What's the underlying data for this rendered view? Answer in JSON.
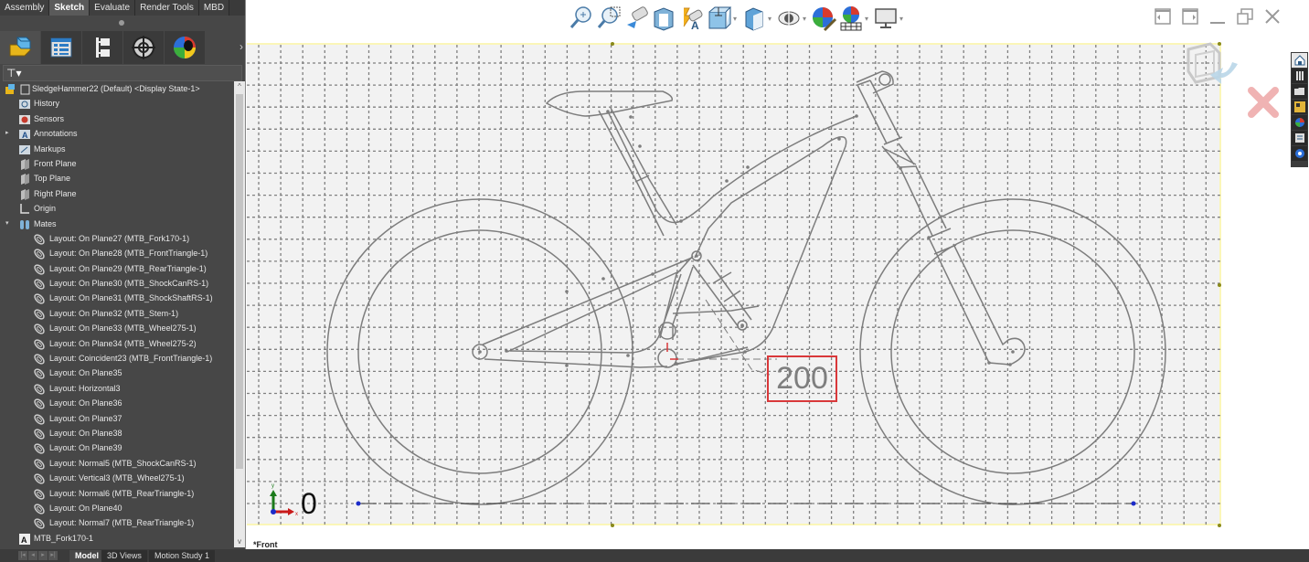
{
  "command_manager": {
    "tabs": [
      {
        "label": "Assembly",
        "active": false
      },
      {
        "label": "Sketch",
        "active": true
      },
      {
        "label": "Evaluate",
        "active": false
      },
      {
        "label": "Render Tools",
        "active": false
      },
      {
        "label": "MBD",
        "active": false
      }
    ]
  },
  "manager_tabs": [
    {
      "name": "featuremanager-tab",
      "icon": "featuremanager-icon"
    },
    {
      "name": "propertymanager-tab",
      "icon": "propertymanager-icon"
    },
    {
      "name": "configurationmanager-tab",
      "icon": "configurationmanager-icon"
    },
    {
      "name": "dimxpertmanager-tab",
      "icon": "crosshair-icon"
    },
    {
      "name": "displaymanager-tab",
      "icon": "appearance-ball-icon"
    }
  ],
  "tree": {
    "root": "SledgeHammer22 (Default) <Display State-1>",
    "items": [
      {
        "label": "History",
        "icon": "history-icon",
        "level": 1,
        "expandable": false
      },
      {
        "label": "Sensors",
        "icon": "sensors-icon",
        "level": 1,
        "expandable": false
      },
      {
        "label": "Annotations",
        "icon": "annotations-icon",
        "level": 1,
        "expandable": true,
        "expanded": false
      },
      {
        "label": "Markups",
        "icon": "markups-icon",
        "level": 1,
        "expandable": false
      },
      {
        "label": "Front Plane",
        "icon": "plane-icon",
        "level": 1,
        "expandable": false
      },
      {
        "label": "Top Plane",
        "icon": "plane-icon",
        "level": 1,
        "expandable": false
      },
      {
        "label": "Right Plane",
        "icon": "plane-icon",
        "level": 1,
        "expandable": false
      },
      {
        "label": "Origin",
        "icon": "origin-icon",
        "level": 1,
        "expandable": false
      },
      {
        "label": "Mates",
        "icon": "mates-icon",
        "level": 1,
        "expandable": true,
        "expanded": true
      },
      {
        "label": "Layout: On Plane27 (MTB_Fork170-1)",
        "icon": "mate-icon",
        "level": 2
      },
      {
        "label": "Layout: On Plane28 (MTB_FrontTriangle-1)",
        "icon": "mate-icon",
        "level": 2
      },
      {
        "label": "Layout: On Plane29 (MTB_RearTriangle-1)",
        "icon": "mate-icon",
        "level": 2
      },
      {
        "label": "Layout: On Plane30 (MTB_ShockCanRS-1)",
        "icon": "mate-icon",
        "level": 2
      },
      {
        "label": "Layout: On Plane31 (MTB_ShockShaftRS-1)",
        "icon": "mate-icon",
        "level": 2
      },
      {
        "label": "Layout: On Plane32 (MTB_Stem-1)",
        "icon": "mate-icon",
        "level": 2
      },
      {
        "label": "Layout: On Plane33 (MTB_Wheel275-1)",
        "icon": "mate-icon",
        "level": 2
      },
      {
        "label": "Layout: On Plane34 (MTB_Wheel275-2)",
        "icon": "mate-icon",
        "level": 2
      },
      {
        "label": "Layout: Coincident23 (MTB_FrontTriangle-1)",
        "icon": "mate-icon",
        "level": 2
      },
      {
        "label": "Layout: On Plane35",
        "icon": "mate-icon",
        "level": 2
      },
      {
        "label": "Layout: Horizontal3",
        "icon": "mate-icon",
        "level": 2
      },
      {
        "label": "Layout: On Plane36",
        "icon": "mate-icon",
        "level": 2
      },
      {
        "label": "Layout: On Plane37",
        "icon": "mate-icon",
        "level": 2
      },
      {
        "label": "Layout: On Plane38",
        "icon": "mate-icon",
        "level": 2
      },
      {
        "label": "Layout: On Plane39",
        "icon": "mate-icon",
        "level": 2
      },
      {
        "label": "Layout: Normal5 (MTB_ShockCanRS-1)",
        "icon": "mate-icon",
        "level": 2
      },
      {
        "label": "Layout: Vertical3 (MTB_Wheel275-1)",
        "icon": "mate-icon",
        "level": 2
      },
      {
        "label": "Layout: Normal6 (MTB_RearTriangle-1)",
        "icon": "mate-icon",
        "level": 2
      },
      {
        "label": "Layout: On Plane40",
        "icon": "mate-icon",
        "level": 2
      },
      {
        "label": "Layout: Normal7 (MTB_RearTriangle-1)",
        "icon": "mate-icon",
        "level": 2
      },
      {
        "label": "MTB_Fork170-1",
        "icon": "part-icon",
        "level": 1
      }
    ]
  },
  "bottom_tabs": [
    {
      "label": "Model",
      "active": true
    },
    {
      "label": "3D Views",
      "active": false
    },
    {
      "label": "Motion Study 1",
      "active": false
    }
  ],
  "heads_up_toolbar": [
    {
      "name": "zoom-to-fit",
      "icon": "zoom-to-fit-icon",
      "dropdown": false
    },
    {
      "name": "zoom-to-area",
      "icon": "zoom-area-icon",
      "dropdown": false
    },
    {
      "name": "previous-view",
      "icon": "previous-view-icon",
      "dropdown": false
    },
    {
      "name": "section-view",
      "icon": "section-view-icon",
      "dropdown": false
    },
    {
      "name": "dynamic-annotation-views",
      "icon": "dynamic-annotation-icon",
      "dropdown": false
    },
    {
      "name": "view-orientation",
      "icon": "view-orientation-icon",
      "dropdown": true
    },
    {
      "name": "display-style",
      "icon": "display-style-icon",
      "dropdown": true
    },
    {
      "name": "hide-show-items",
      "icon": "eye-icon",
      "dropdown": true
    },
    {
      "name": "edit-appearance",
      "icon": "edit-appearance-icon",
      "dropdown": false
    },
    {
      "name": "apply-scene",
      "icon": "scene-icon",
      "dropdown": true
    },
    {
      "name": "view-settings",
      "icon": "monitor-icon",
      "dropdown": true
    }
  ],
  "task_pane": [
    {
      "name": "solidworks-resources",
      "icon": "home-icon"
    },
    {
      "name": "design-library",
      "icon": "library-icon"
    },
    {
      "name": "file-explorer",
      "icon": "folder-icon"
    },
    {
      "name": "view-palette",
      "icon": "view-palette-icon"
    },
    {
      "name": "appearances",
      "icon": "appearances-icon"
    },
    {
      "name": "custom-properties",
      "icon": "properties-icon"
    },
    {
      "name": "solidworks-forum",
      "icon": "forum-icon"
    }
  ],
  "graphics": {
    "view_name": "*Front",
    "dimension_value": "200",
    "origin_label": "0",
    "axis_x_label": "x",
    "axis_y_label": "y"
  },
  "colors": {
    "sketch_line": "#7d7d7d",
    "grid": "#808080",
    "dimension_box": "#d9383a",
    "sketch_bg": "#f2f2f2",
    "sketch_border": "#fbf6b8"
  }
}
